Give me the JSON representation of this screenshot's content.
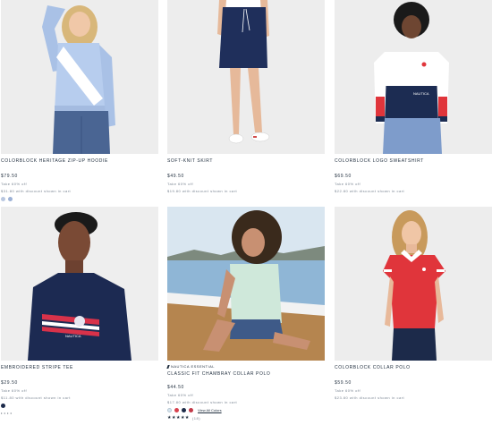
{
  "products": [
    {
      "title": "COLORBLOCK HERITAGE ZIP-UP HOODIE",
      "price": "$79.50",
      "discount": "Take 60% off",
      "discount_price": "$31.80 with discount shown in cart",
      "swatches": [
        "#b9c7e0",
        "#9cb1d6"
      ]
    },
    {
      "title": "SOFT-KNIT SKIRT",
      "price": "$49.50",
      "discount": "Take 60% off",
      "discount_price": "$19.80 with discount shown in cart"
    },
    {
      "title": "COLORBLOCK LOGO SWEATSHIRT",
      "price": "$69.50",
      "discount": "Take 60% off",
      "discount_price": "$22.80 with discount shown in cart"
    },
    {
      "title": "EMBROIDERED STRIPE TEE",
      "price": "$29.50",
      "discount": "Take 60% off",
      "discount_price": "$11.80 with discount shown in cart",
      "swatches": [
        "#1c2a4a"
      ],
      "rating_stars": "• • • •"
    },
    {
      "tag": "NAUTICA ESSENTIAL",
      "title": "CLASSIC FIT CHAMBRAY COLLAR POLO",
      "price": "$44.50",
      "discount": "Take 60% off",
      "discount_price": "$17.80 with discount shown in cart",
      "swatches": [
        "#d8e6ef",
        "#d7414d",
        "#1d2b48",
        "#c23948"
      ],
      "view_all": "View All Colors",
      "rating_stars": "★★★★★",
      "rating_count": "(18)"
    },
    {
      "title": "COLORBLOCK COLLAR POLO",
      "price": "$59.50",
      "discount": "Take 60% off",
      "discount_price": "$23.80 with discount shown in cart"
    }
  ],
  "colors": {
    "navy": "#1b2a3a",
    "red": "#e0353b",
    "mint": "#cfe8da",
    "denim": "#4e6a96",
    "light_blue": "#a5bfe3"
  }
}
